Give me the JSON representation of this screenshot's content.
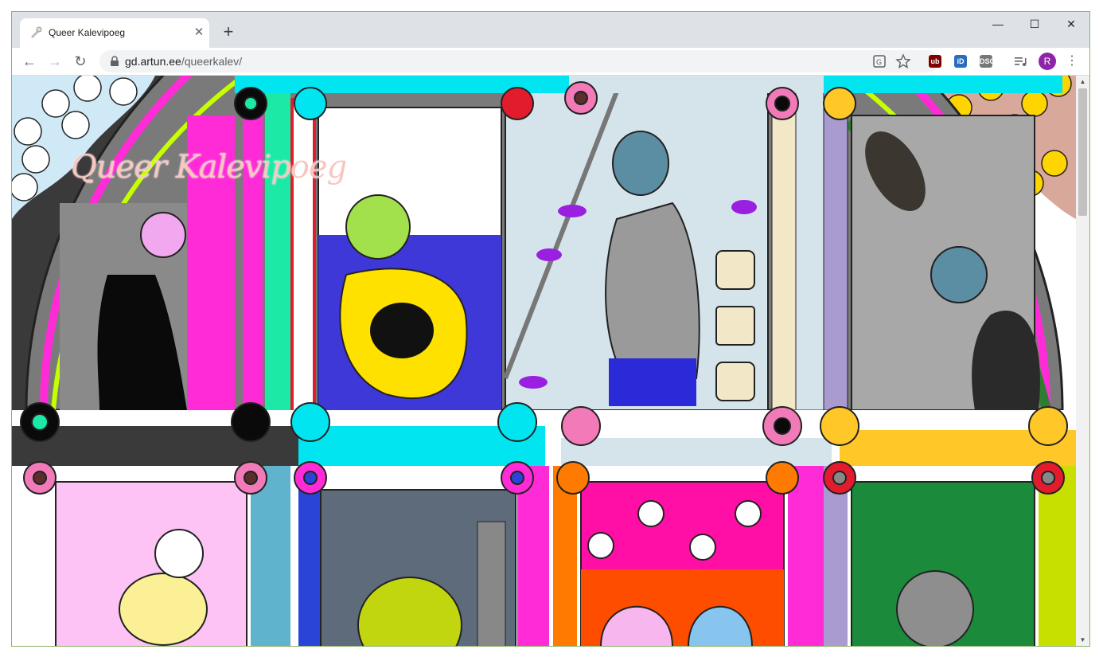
{
  "browser": {
    "tab": {
      "title": "Queer Kalevipoeg",
      "close_glyph": "✕"
    },
    "new_tab_glyph": "+",
    "window_controls": {
      "minimize": "—",
      "maximize": "☐",
      "close": "✕"
    },
    "nav": {
      "back": "←",
      "forward": "→",
      "reload": "↻"
    },
    "address": {
      "host": "gd.artun.ee",
      "path": "/queerkalev/"
    },
    "extensions": [
      {
        "name": "ublock-icon",
        "label": "ub",
        "color": "#800000"
      },
      {
        "name": "id-extension-icon",
        "label": "iD",
        "color": "#2a6ebb"
      },
      {
        "name": "dsc-extension-icon",
        "label": "DSC",
        "color": "#777777"
      }
    ],
    "profile_initial": "R",
    "accent": "#8e24aa"
  },
  "page": {
    "title": "Queer Kalevipoeg",
    "title_color": "#f7c7c0"
  }
}
